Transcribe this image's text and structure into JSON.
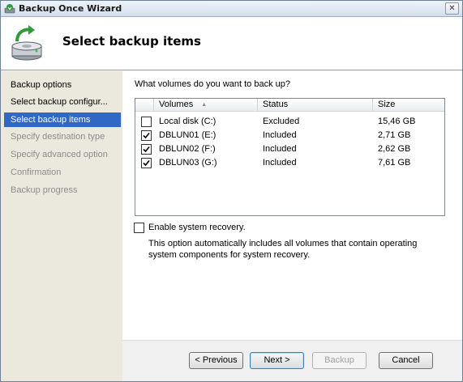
{
  "window": {
    "title": "Backup Once Wizard",
    "close_glyph": "✕"
  },
  "header": {
    "title": "Select backup items",
    "icon": "disk-backup-icon"
  },
  "nav": {
    "items": [
      {
        "label": "Backup options",
        "state": "done"
      },
      {
        "label": "Select backup configur...",
        "state": "done"
      },
      {
        "label": "Select backup items",
        "state": "active"
      },
      {
        "label": "Specify destination type",
        "state": "todo"
      },
      {
        "label": "Specify advanced option",
        "state": "todo"
      },
      {
        "label": "Confirmation",
        "state": "todo"
      },
      {
        "label": "Backup progress",
        "state": "todo"
      }
    ]
  },
  "content": {
    "question": "What volumes do you want to back up?",
    "columns": [
      "Volumes",
      "Status",
      "Size"
    ],
    "volumes": [
      {
        "name": "Local disk (C:)",
        "status": "Excluded",
        "size": "15,46 GB",
        "checked": false
      },
      {
        "name": "DBLUN01 (E:)",
        "status": "Included",
        "size": "2,71 GB",
        "checked": true
      },
      {
        "name": "DBLUN02 (F:)",
        "status": "Included",
        "size": "2,62 GB",
        "checked": true
      },
      {
        "name": "DBLUN03 (G:)",
        "status": "Included",
        "size": "7,61 GB",
        "checked": true
      }
    ],
    "recovery": {
      "label": "Enable system recovery.",
      "checked": false,
      "description": "This option automatically includes all volumes that contain operating system components for system recovery."
    }
  },
  "buttons": {
    "previous": "< Previous",
    "next": "Next >",
    "backup": "Backup",
    "cancel": "Cancel"
  },
  "colors": {
    "nav_active": "#3168c6",
    "nav_background": "#ebe8dd",
    "disabled_text": "#8c8c8c"
  }
}
